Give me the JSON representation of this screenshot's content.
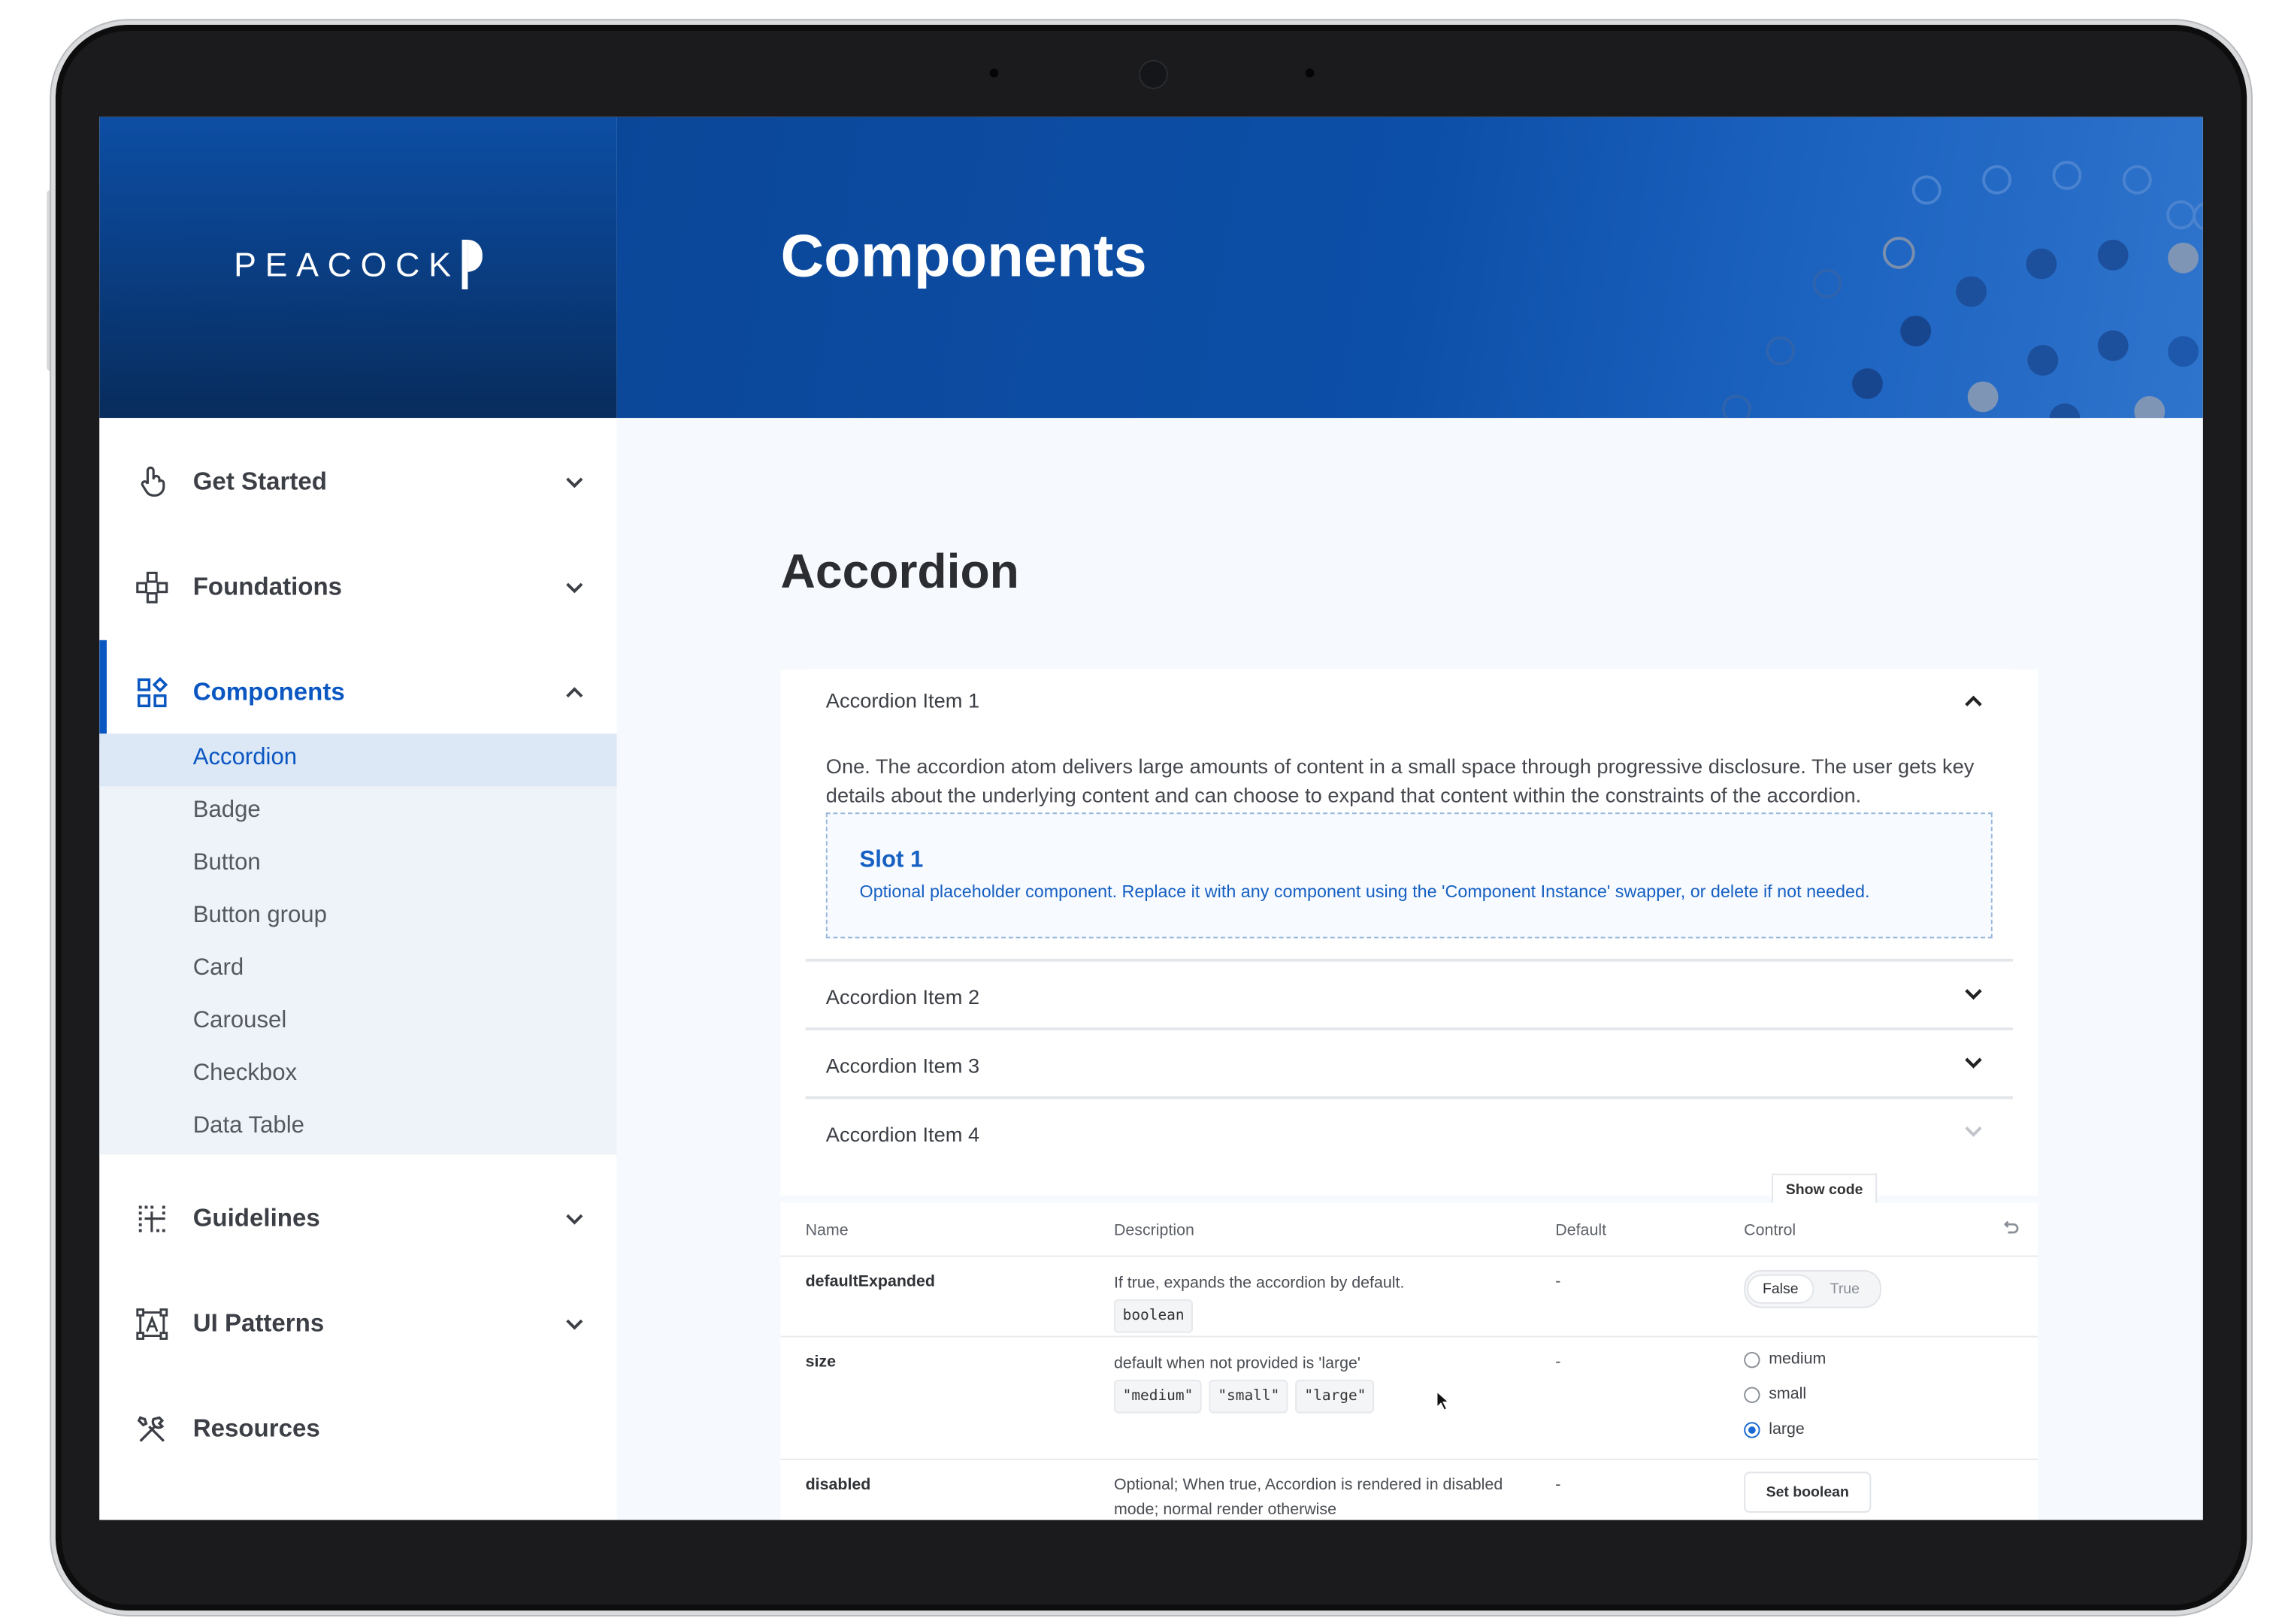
{
  "header": {
    "brand": "PEACOCK",
    "title": "Components"
  },
  "sidebar": {
    "items": [
      {
        "label": "Get Started",
        "icon": "hand-pointer-icon",
        "expanded": false
      },
      {
        "label": "Foundations",
        "icon": "network-icon",
        "expanded": false
      },
      {
        "label": "Components",
        "icon": "grid-components-icon",
        "expanded": true,
        "active": true
      },
      {
        "label": "Guidelines",
        "icon": "dotted-grid-icon",
        "expanded": false
      },
      {
        "label": "UI Patterns",
        "icon": "frame-text-icon",
        "expanded": false
      },
      {
        "label": "Resources",
        "icon": "tools-icon"
      }
    ],
    "sub_items": [
      "Accordion",
      "Badge",
      "Button",
      "Button group",
      "Card",
      "Carousel",
      "Checkbox",
      "Data Table"
    ],
    "active_sub": "Accordion"
  },
  "page": {
    "title": "Accordion"
  },
  "accordion": {
    "items": [
      {
        "label": "Accordion Item 1",
        "expanded": true
      },
      {
        "label": "Accordion Item 2",
        "expanded": false
      },
      {
        "label": "Accordion Item 3",
        "expanded": false
      },
      {
        "label": "Accordion Item 4",
        "expanded": false
      }
    ],
    "body_text": "One. The accordion atom delivers large amounts of content in a small space through progressive disclosure. The user gets key details about the underlying content and can choose to expand that content within the constraints of the accordion.",
    "slot_title": "Slot 1",
    "slot_desc": "Optional placeholder component. Replace it with any component using the 'Component Instance' swapper, or delete if not needed."
  },
  "show_code": "Show code",
  "args_table": {
    "columns": [
      "Name",
      "Description",
      "Default",
      "Control"
    ],
    "rows": [
      {
        "name": "defaultExpanded",
        "description": "If true, expands the accordion by default.",
        "type": "boolean",
        "default": "-",
        "control": {
          "false_label": "False",
          "true_label": "True",
          "selected": "False"
        }
      },
      {
        "name": "size",
        "description": "default when not provided is 'large'",
        "options": [
          "\"medium\"",
          "\"small\"",
          "\"large\""
        ],
        "default": "-",
        "control": {
          "radios": [
            "medium",
            "small",
            "large"
          ],
          "selected": "large"
        }
      },
      {
        "name": "disabled",
        "description": "Optional; When true, Accordion is rendered in disabled mode; normal render otherwise",
        "default": "-",
        "control": {
          "button": "Set boolean"
        }
      }
    ]
  },
  "colors": {
    "primary": "#0b57c2",
    "header": "#0c4fa8",
    "nav_active_bg": "#dde8f6"
  }
}
